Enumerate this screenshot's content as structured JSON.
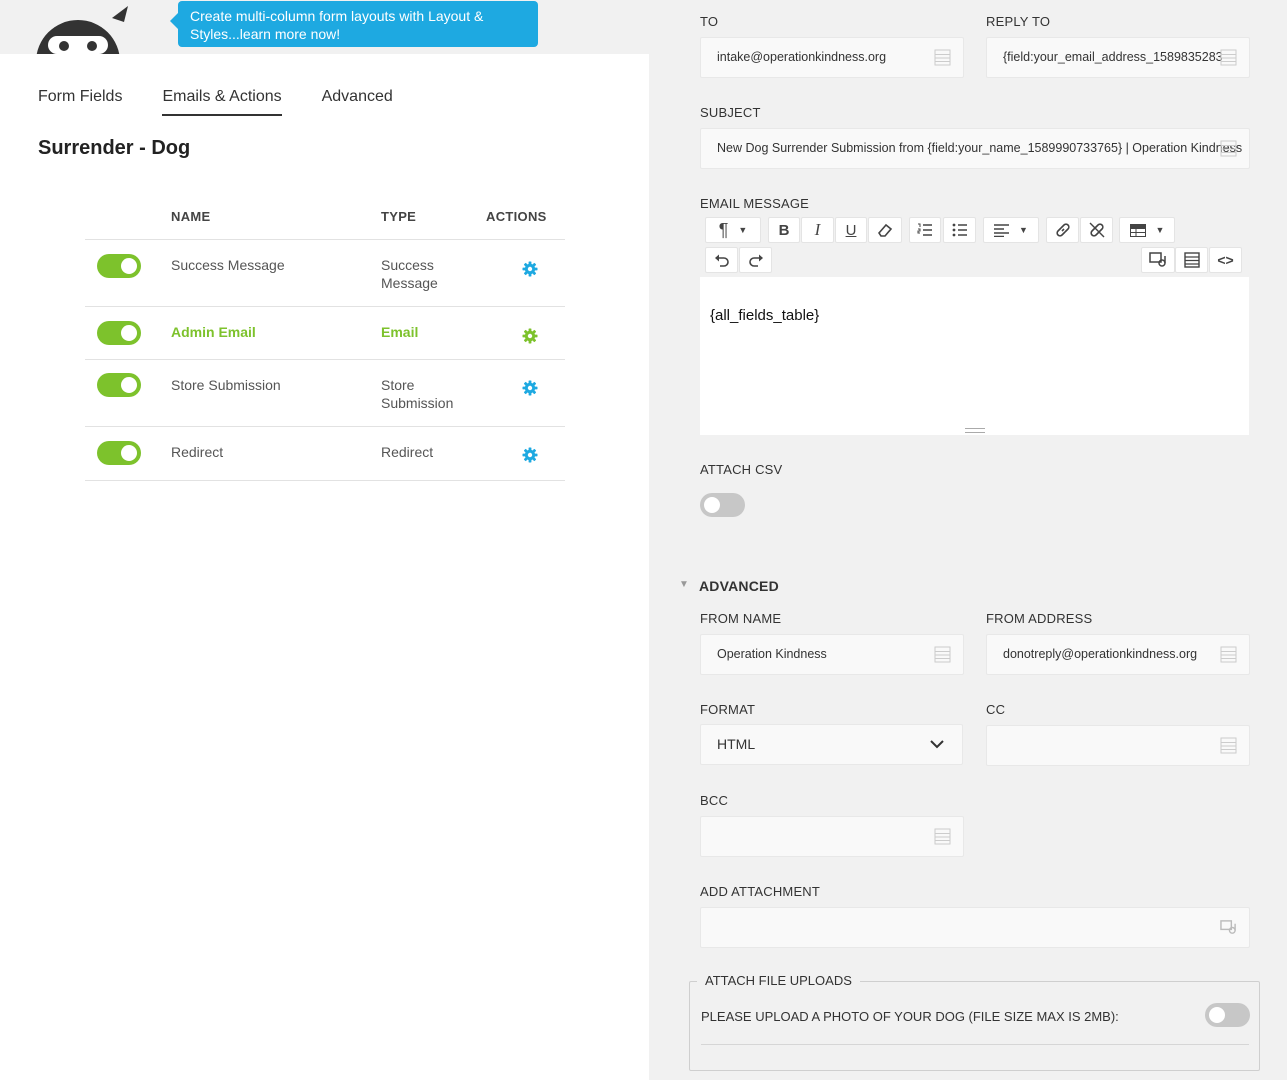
{
  "tooltip": {
    "text": "Create multi-column form layouts with Layout & Styles...learn more now!"
  },
  "tabs": [
    {
      "label": "Form Fields"
    },
    {
      "label": "Emails & Actions",
      "active": true
    },
    {
      "label": "Advanced"
    }
  ],
  "form": {
    "title": "Surrender - Dog"
  },
  "actions_table": {
    "headers": {
      "name": "NAME",
      "type": "TYPE",
      "actions": "ACTIONS"
    },
    "rows": [
      {
        "name": "Success Message",
        "type": "Success Message",
        "enabled": true,
        "highlighted": false
      },
      {
        "name": "Admin Email",
        "type": "Email",
        "enabled": true,
        "highlighted": true
      },
      {
        "name": "Store Submission",
        "type": "Store Submission",
        "enabled": true,
        "highlighted": false
      },
      {
        "name": "Redirect",
        "type": "Redirect",
        "enabled": true,
        "highlighted": false
      }
    ]
  },
  "settings": {
    "to": {
      "label": "TO",
      "value": "intake@operationkindness.org"
    },
    "reply_to": {
      "label": "REPLY TO",
      "value": "{field:your_email_address_1589835283"
    },
    "subject": {
      "label": "SUBJECT",
      "value": "New Dog Surrender Submission from {field:your_name_1589990733765} | Operation Kindness"
    },
    "email_message": {
      "label": "EMAIL MESSAGE",
      "content": "{all_fields_table}"
    },
    "attach_csv": {
      "label": "ATTACH CSV",
      "enabled": false
    },
    "advanced": {
      "heading": "ADVANCED",
      "from_name": {
        "label": "FROM NAME",
        "value": "Operation Kindness"
      },
      "from_address": {
        "label": "FROM ADDRESS",
        "value": "donotreply@operationkindness.org"
      },
      "format": {
        "label": "FORMAT",
        "value": "HTML"
      },
      "cc": {
        "label": "CC",
        "value": ""
      },
      "bcc": {
        "label": "BCC",
        "value": ""
      },
      "add_attachment": {
        "label": "ADD ATTACHMENT",
        "value": ""
      },
      "attach_file_uploads": {
        "legend": "ATTACH FILE UPLOADS",
        "item_label": "PLEASE UPLOAD A PHOTO OF YOUR DOG (FILE SIZE MAX IS 2MB):",
        "enabled": false
      }
    }
  },
  "colors": {
    "accent_green": "#7dc22c",
    "tooltip_blue": "#1ea9e1",
    "gear_blue": "#1ea9e1"
  }
}
